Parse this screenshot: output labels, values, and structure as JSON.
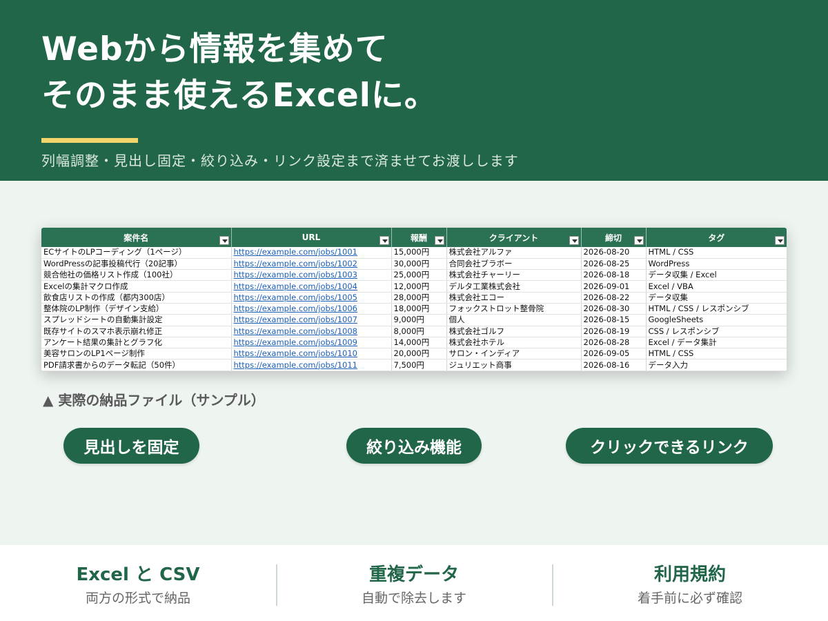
{
  "hero": {
    "title_line1": "Webから情報を集めて",
    "title_line2": "そのまま使えるExcelに。",
    "subtitle": "列幅調整・見出し固定・絞り込み・リンク設定まで済ませてお渡しします",
    "accent_color": "#f2d56b",
    "bg_color": "#216649"
  },
  "sheet": {
    "columns": [
      "案件名",
      "URL",
      "報酬",
      "クライアント",
      "締切",
      "タグ"
    ],
    "rows": [
      [
        "ECサイトのLPコーディング（1ページ）",
        "https://example.com/jobs/1001",
        "15,000円",
        "株式会社アルファ",
        "2026-08-20",
        "HTML / CSS"
      ],
      [
        "WordPressの記事投稿代行（20記事）",
        "https://example.com/jobs/1002",
        "30,000円",
        "合同会社ブラボー",
        "2026-08-25",
        "WordPress"
      ],
      [
        "競合他社の価格リスト作成（100社）",
        "https://example.com/jobs/1003",
        "25,000円",
        "株式会社チャーリー",
        "2026-08-18",
        "データ収集 / Excel"
      ],
      [
        "Excelの集計マクロ作成",
        "https://example.com/jobs/1004",
        "12,000円",
        "デルタ工業株式会社",
        "2026-09-01",
        "Excel / VBA"
      ],
      [
        "飲食店リストの作成（都内300店）",
        "https://example.com/jobs/1005",
        "28,000円",
        "株式会社エコー",
        "2026-08-22",
        "データ収集"
      ],
      [
        "整体院のLP制作（デザイン支給）",
        "https://example.com/jobs/1006",
        "18,000円",
        "フォックストロット整骨院",
        "2026-08-30",
        "HTML / CSS / レスポンシブ"
      ],
      [
        "スプレッドシートの自動集計設定",
        "https://example.com/jobs/1007",
        "9,000円",
        "個人",
        "2026-08-15",
        "GoogleSheets"
      ],
      [
        "既存サイトのスマホ表示崩れ修正",
        "https://example.com/jobs/1008",
        "8,000円",
        "株式会社ゴルフ",
        "2026-08-19",
        "CSS / レスポンシブ"
      ],
      [
        "アンケート結果の集計とグラフ化",
        "https://example.com/jobs/1009",
        "14,000円",
        "株式会社ホテル",
        "2026-08-28",
        "Excel / データ集計"
      ],
      [
        "美容サロンのLP1ページ制作",
        "https://example.com/jobs/1010",
        "20,000円",
        "サロン・インディア",
        "2026-09-05",
        "HTML / CSS"
      ],
      [
        "PDF請求書からのデータ転記（50件）",
        "https://example.com/jobs/1011",
        "7,500円",
        "ジュリエット商事",
        "2026-08-16",
        "データ入力"
      ]
    ]
  },
  "caption": "▲ 実際の納品ファイル（サンプル）",
  "pills": [
    "見出しを固定",
    "絞り込み機能",
    "クリックできるリンク"
  ],
  "features": [
    {
      "title": "Excel と CSV",
      "subtitle": "両方の形式で納品"
    },
    {
      "title": "重複データ",
      "subtitle": "自動で除去します"
    },
    {
      "title": "利用規約",
      "subtitle": "着手前に必ず確認"
    }
  ]
}
